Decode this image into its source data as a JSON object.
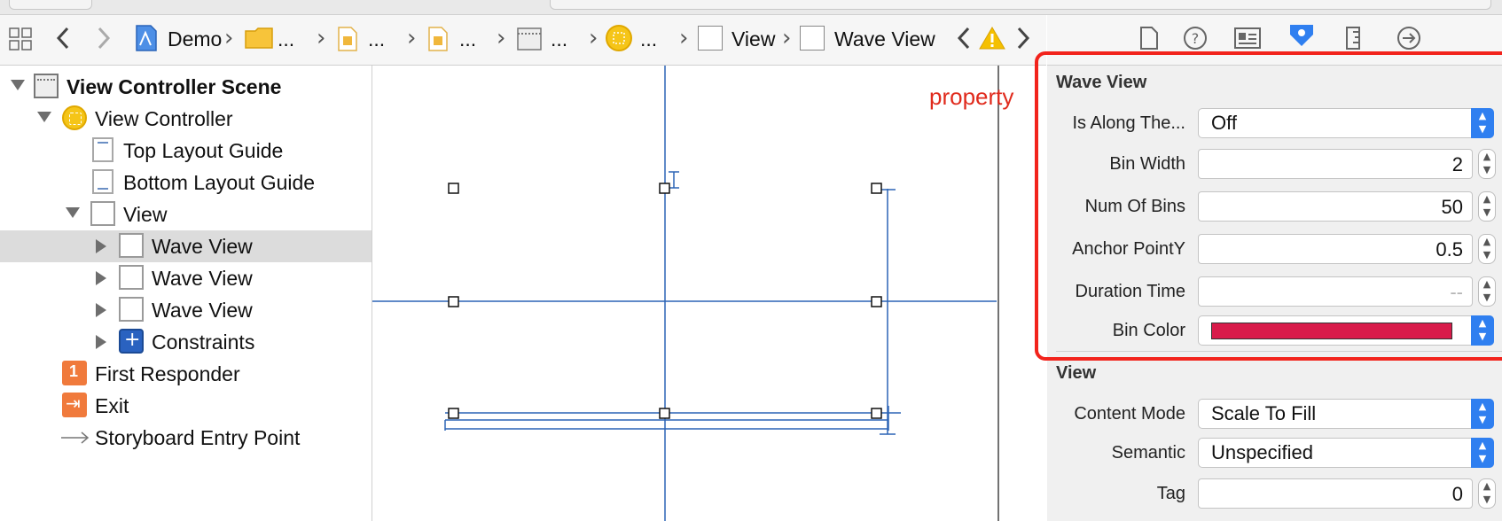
{
  "jumpbar": {
    "items": [
      {
        "label": "Demo"
      },
      {
        "label": "..."
      },
      {
        "label": "..."
      },
      {
        "label": "..."
      },
      {
        "label": "..."
      },
      {
        "label": "..."
      },
      {
        "label": "View"
      },
      {
        "label": "Wave View"
      }
    ]
  },
  "navigator": {
    "items": [
      {
        "label": "View Controller Scene"
      },
      {
        "label": "View Controller"
      },
      {
        "label": "Top Layout Guide"
      },
      {
        "label": "Bottom Layout Guide"
      },
      {
        "label": "View"
      },
      {
        "label": "Wave View"
      },
      {
        "label": "Wave View"
      },
      {
        "label": "Wave View"
      },
      {
        "label": "Constraints"
      },
      {
        "label": "First Responder"
      },
      {
        "label": "Exit"
      },
      {
        "label": "Storyboard Entry Point"
      }
    ]
  },
  "annotation": "property",
  "inspector": {
    "wave_section": {
      "title": "Wave View",
      "is_along_label": "Is Along The...",
      "is_along_value": "Off",
      "bin_width_label": "Bin Width",
      "bin_width_value": "2",
      "num_bins_label": "Num Of Bins",
      "num_bins_value": "50",
      "anchor_label": "Anchor PointY",
      "anchor_value": "0.5",
      "duration_label": "Duration Time",
      "duration_placeholder": "--",
      "bin_color_label": "Bin Color",
      "bin_color_value": "#d81b4a"
    },
    "view_section": {
      "title": "View",
      "content_mode_label": "Content Mode",
      "content_mode_value": "Scale To Fill",
      "semantic_label": "Semantic",
      "semantic_value": "Unspecified",
      "tag_label": "Tag",
      "tag_value": "0"
    }
  },
  "colors": {
    "selection": "#2f7ff0",
    "highlight_box": "#f2231c",
    "annotation": "#e02a1c",
    "guide_lines": "#2c64b5"
  }
}
